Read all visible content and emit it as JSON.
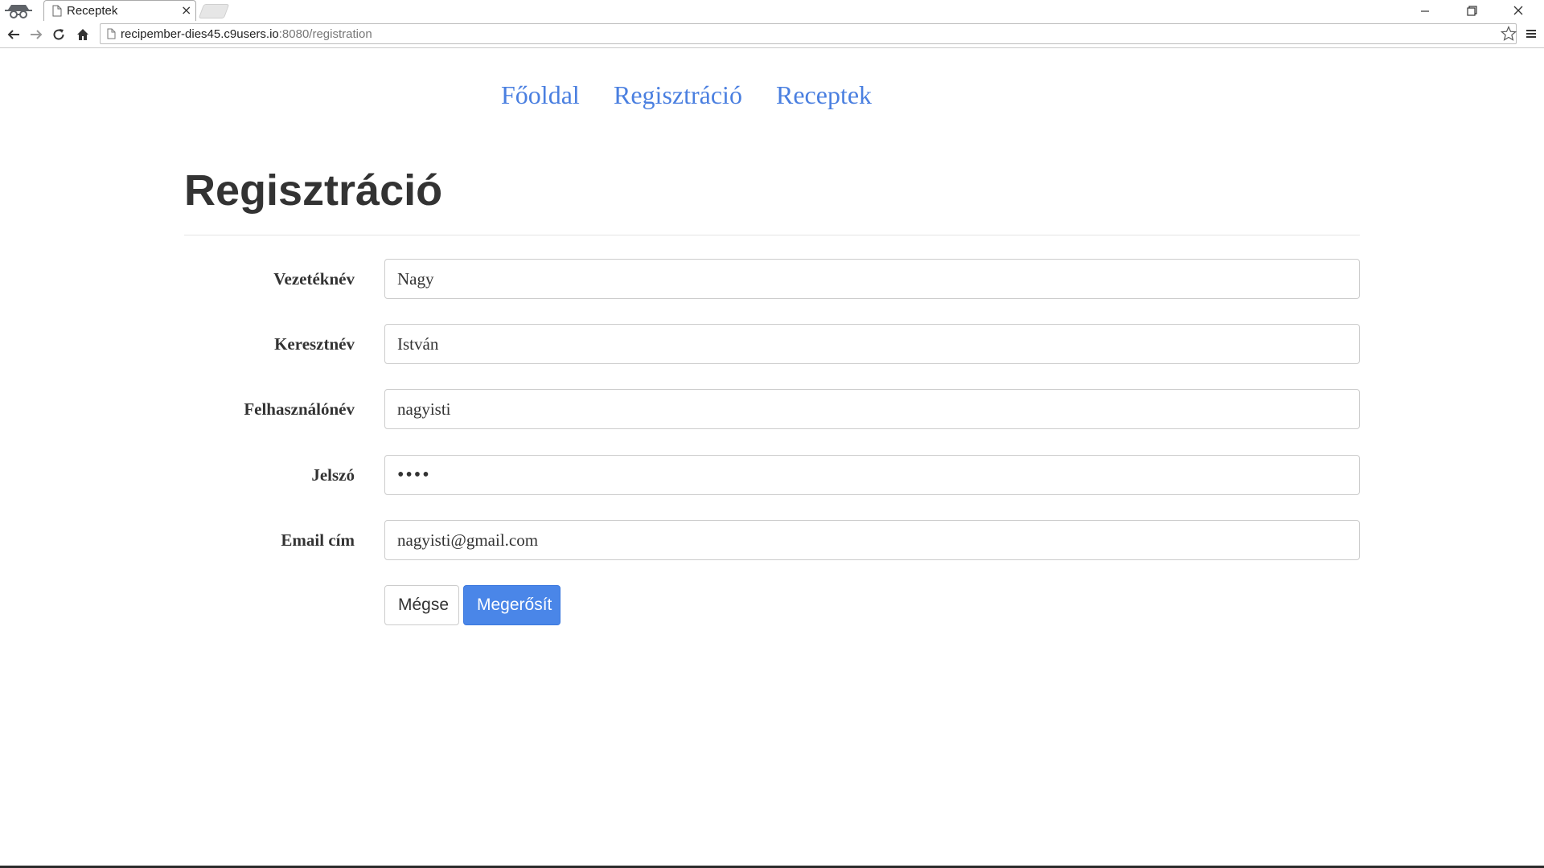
{
  "browser": {
    "tab_title": "Receptek",
    "tab_close": "×",
    "url_host": "recipember-dies45.c9users.io",
    "url_rest": ":8080/registration"
  },
  "nav": {
    "home": "Főoldal",
    "registration": "Regisztráció",
    "recipes": "Receptek",
    "link_color": "#4a7fe0"
  },
  "page": {
    "title": "Regisztráció"
  },
  "form": {
    "fields": [
      {
        "label": "Vezetéknév",
        "value": "Nagy",
        "type": "text"
      },
      {
        "label": "Keresztnév",
        "value": "István",
        "type": "text"
      },
      {
        "label": "Felhasználónév",
        "value": "nagyisti",
        "type": "text"
      },
      {
        "label": "Jelszó",
        "value": "1234",
        "type": "password"
      },
      {
        "label": "Email cím",
        "value": "nagyisti@gmail.com",
        "type": "email"
      }
    ],
    "cancel_label": "Mégse",
    "confirm_label": "Megerősít",
    "confirm_color": "#4a86e8"
  }
}
